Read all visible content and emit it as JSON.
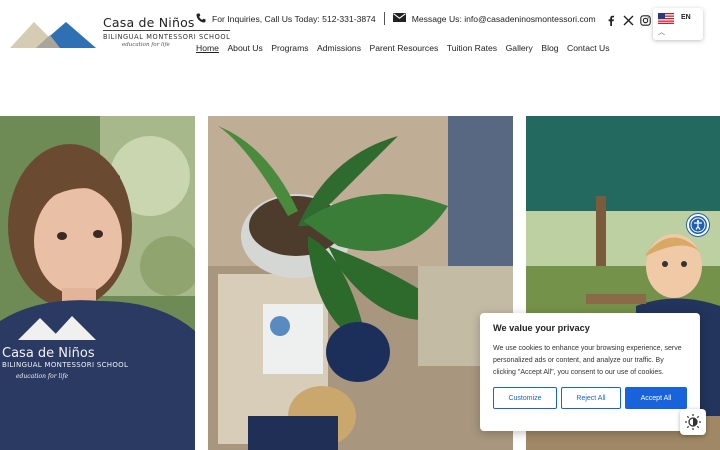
{
  "brand": {
    "name": "Casa de Niños",
    "subtitle": "BILINGUAL MONTESSORI SCHOOL",
    "tagline": "education for life",
    "colors": {
      "mountain_light": "#d6cbb3",
      "mountain_blue": "#2f6fb4"
    }
  },
  "contact": {
    "phone_text": "For Inquiries, Call Us Today: 512-331-3874",
    "email_text": "Message Us: info@casadeninosmontessori.com",
    "phone_icon": "phone-icon",
    "mail_icon": "mail-icon"
  },
  "social": [
    "facebook-icon",
    "x-icon",
    "instagram-icon"
  ],
  "language": {
    "code": "EN",
    "flag": "us-flag-icon"
  },
  "nav": {
    "items": [
      {
        "label": "Home",
        "active": true
      },
      {
        "label": "About Us"
      },
      {
        "label": "Programs"
      },
      {
        "label": "Admissions"
      },
      {
        "label": "Parent Resources"
      },
      {
        "label": "Tuition Rates"
      },
      {
        "label": "Gallery"
      },
      {
        "label": "Blog"
      },
      {
        "label": "Contact Us"
      }
    ]
  },
  "shirt": {
    "line1": "Casa de Niños",
    "line2": "BILINGUAL MONTESSORI SCHOOL",
    "line3": "education for life"
  },
  "cookie": {
    "title": "We value your privacy",
    "body": "We use cookies to enhance your browsing experience, serve personalized ads or content, and analyze our traffic. By clicking \"Accept All\", you consent to our use of cookies.",
    "customize_label": "Customize",
    "reject_label": "Reject All",
    "accept_label": "Accept All",
    "accent": "#1863dc"
  }
}
